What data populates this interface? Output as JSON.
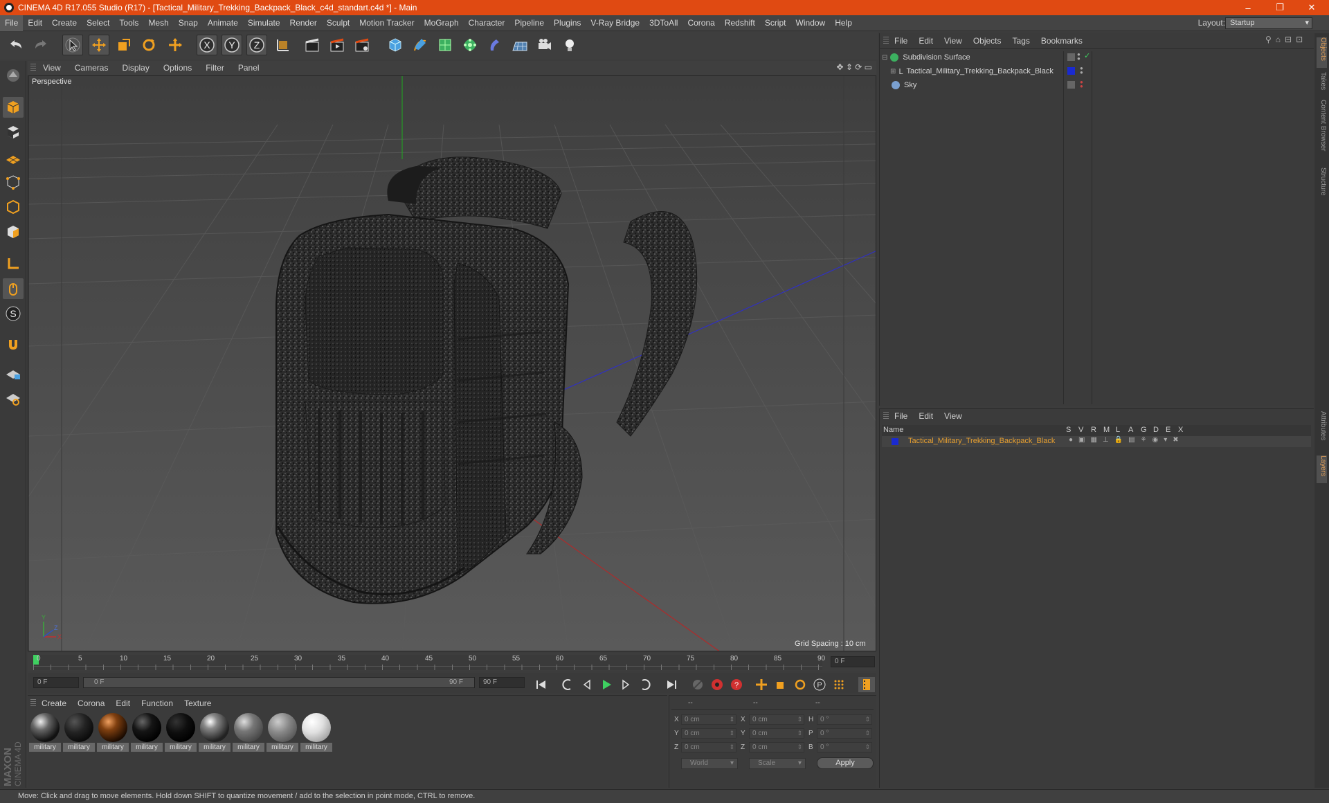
{
  "window": {
    "title": "CINEMA 4D R17.055 Studio (R17) - [Tactical_Military_Trekking_Backpack_Black_c4d_standart.c4d *] - Main",
    "minimize": "–",
    "restore": "❐",
    "close": "✕"
  },
  "menubar": {
    "items": [
      "File",
      "Edit",
      "Create",
      "Select",
      "Tools",
      "Mesh",
      "Snap",
      "Animate",
      "Simulate",
      "Render",
      "Sculpt",
      "Motion Tracker",
      "MoGraph",
      "Character",
      "Pipeline",
      "Plugins",
      "V-Ray Bridge",
      "3DToAll",
      "Corona",
      "Redshift",
      "Script",
      "Window",
      "Help"
    ],
    "layout_label": "Layout:",
    "layout_value": "Startup"
  },
  "toolbar": {
    "axis_x": "X",
    "axis_y": "Y",
    "axis_z": "Z"
  },
  "viewport": {
    "menu": [
      "View",
      "Cameras",
      "Display",
      "Options",
      "Filter",
      "Panel"
    ],
    "camera_label": "Perspective",
    "grid_spacing": "Grid Spacing : 10 cm"
  },
  "timeline": {
    "ticks": [
      "0",
      "5",
      "10",
      "15",
      "20",
      "25",
      "30",
      "35",
      "40",
      "45",
      "50",
      "55",
      "60",
      "65",
      "70",
      "75",
      "80",
      "85",
      "90"
    ],
    "current_frame": "0 F",
    "start_field": "0 F",
    "range_start": "0 F",
    "range_end": "90 F",
    "end_field": "90 F"
  },
  "materials": {
    "menu": [
      "Create",
      "Corona",
      "Edit",
      "Function",
      "Texture"
    ],
    "items": [
      {
        "label": "military"
      },
      {
        "label": "military"
      },
      {
        "label": "military"
      },
      {
        "label": "military"
      },
      {
        "label": "military"
      },
      {
        "label": "military"
      },
      {
        "label": "military"
      },
      {
        "label": "military"
      },
      {
        "label": "military"
      }
    ]
  },
  "coordinates": {
    "header": [
      "--",
      "--",
      "--"
    ],
    "rows": [
      {
        "l1": "X",
        "v1": "0 cm",
        "l2": "X",
        "v2": "0 cm",
        "l3": "H",
        "v3": "0 °"
      },
      {
        "l1": "Y",
        "v1": "0 cm",
        "l2": "Y",
        "v2": "0 cm",
        "l3": "P",
        "v3": "0 °"
      },
      {
        "l1": "Z",
        "v1": "0 cm",
        "l2": "Z",
        "v2": "0 cm",
        "l3": "B",
        "v3": "0 °"
      }
    ],
    "space": "World",
    "mode": "Scale",
    "apply": "Apply"
  },
  "object_manager": {
    "menu": [
      "File",
      "Edit",
      "View",
      "Objects",
      "Tags",
      "Bookmarks"
    ],
    "objects": [
      {
        "name": "Subdivision Surface"
      },
      {
        "name": "Tactical_Military_Trekking_Backpack_Black"
      },
      {
        "name": "Sky"
      }
    ]
  },
  "layer_manager": {
    "menu": [
      "File",
      "Edit",
      "View"
    ],
    "columns": [
      "Name",
      "S",
      "V",
      "R",
      "M",
      "L",
      "A",
      "G",
      "D",
      "E",
      "X"
    ],
    "layer_name": "Tactical_Military_Trekking_Backpack_Black"
  },
  "right_tabs": [
    "Objects",
    "Takes",
    "Content Browser",
    "Structure",
    "Attributes",
    "Layers"
  ],
  "status": "Move: Click and drag to move elements. Hold down SHIFT to quantize movement / add to the selection in point mode, CTRL to remove.",
  "colors": {
    "title_bar": "#e04a12",
    "accent_orange": "#f0a020",
    "layer_name": "#e8a030"
  }
}
